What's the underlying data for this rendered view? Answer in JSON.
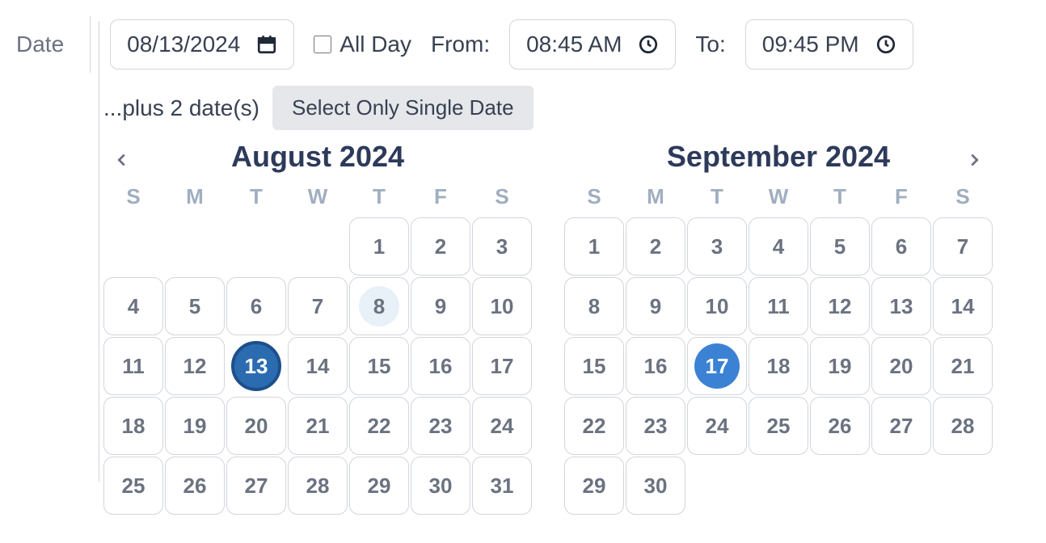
{
  "labels": {
    "date": "Date",
    "allDay": "All Day",
    "from": "From:",
    "to": "To:",
    "plusDates": "...plus 2 date(s)",
    "singleDateBtn": "Select Only Single Date"
  },
  "inputs": {
    "dateValue": "08/13/2024",
    "fromTime": "08:45 AM",
    "toTime": "09:45 PM"
  },
  "weekdays": [
    "S",
    "M",
    "T",
    "W",
    "T",
    "F",
    "S"
  ],
  "calendarLeft": {
    "title": "August 2024",
    "leadingBlanks": 4,
    "daysInMonth": 31,
    "highlighted": 8,
    "selectedPrimary": 13
  },
  "calendarRight": {
    "title": "September 2024",
    "leadingBlanks": 0,
    "daysInMonth": 30,
    "selectedSecondary": 17
  }
}
